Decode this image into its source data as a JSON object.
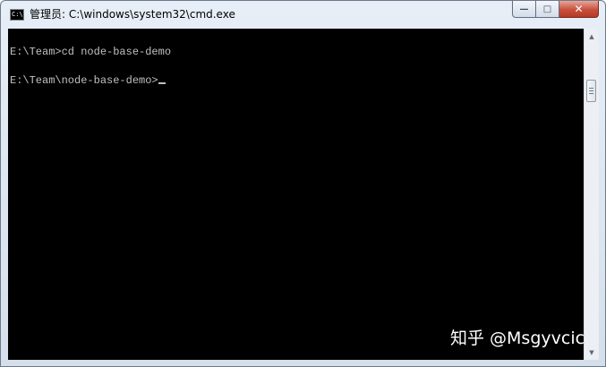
{
  "window": {
    "title": "管理员: C:\\windows\\system32\\cmd.exe",
    "icon": "cmd-icon",
    "icon_label": "C:\\",
    "controls": {
      "minimize": "—",
      "maximize": "□",
      "close": "✕"
    }
  },
  "console": {
    "lines": [
      "E:\\Team>cd node-base-demo",
      "E:\\Team\\node-base-demo>"
    ],
    "foreground": "#c0c0c0",
    "background": "#000000"
  },
  "scrollbar": {
    "up_arrow": "▲",
    "down_arrow": "▼"
  },
  "watermark": "知乎 @Msgyvcici"
}
